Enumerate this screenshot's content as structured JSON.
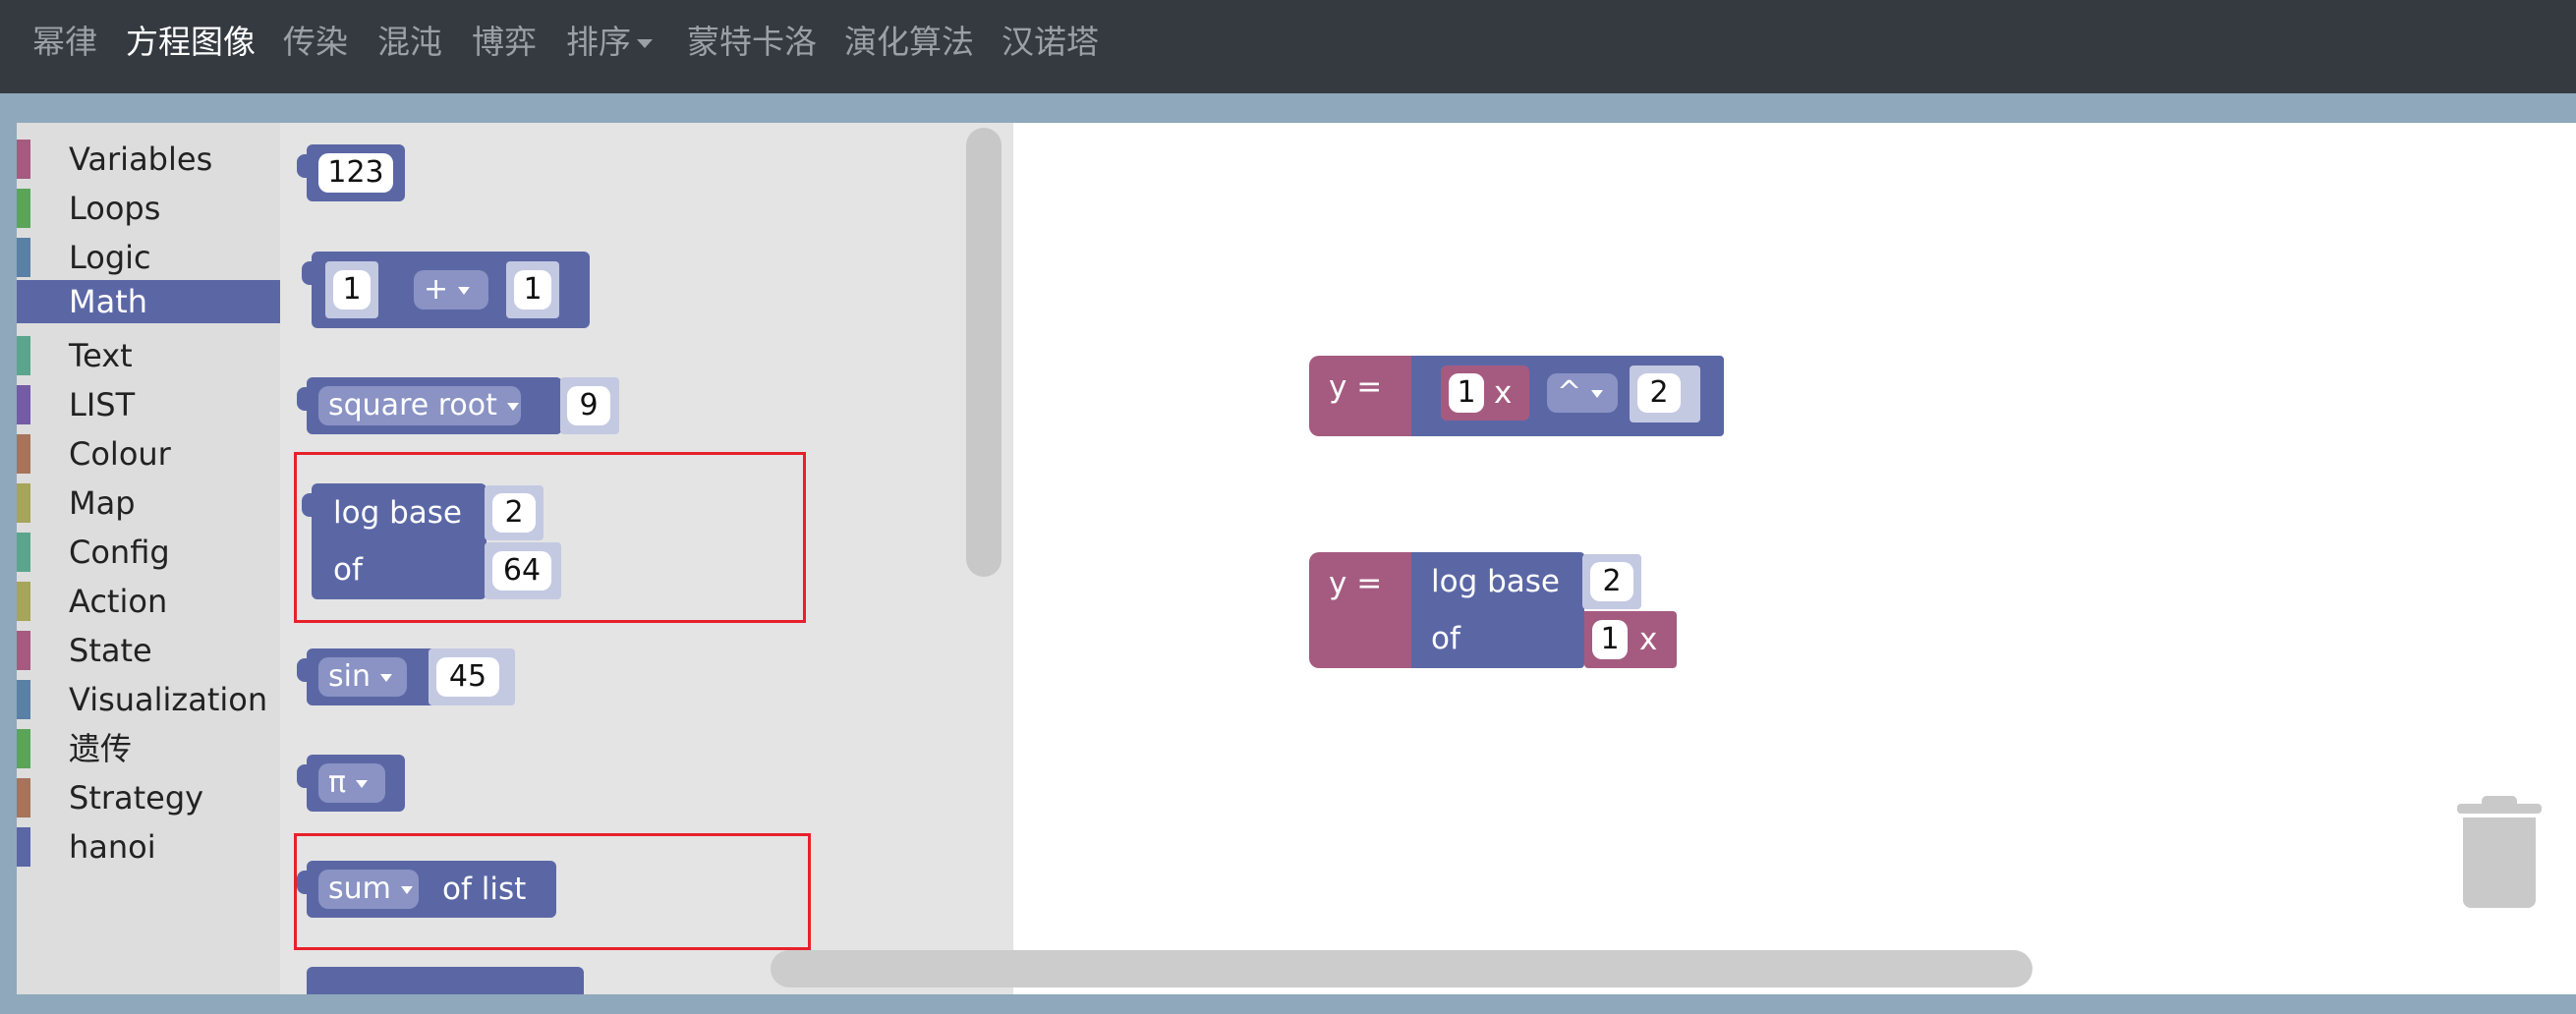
{
  "nav": {
    "items": [
      "幂律",
      "方程图像",
      "传染",
      "混沌",
      "博弈",
      "排序",
      "蒙特卡洛",
      "演化算法",
      "汉诺塔"
    ],
    "active": "方程图像"
  },
  "toolbox": {
    "categories": [
      {
        "label": "Variables",
        "color": "#a55b80"
      },
      {
        "label": "Loops",
        "color": "#5ba55b"
      },
      {
        "label": "Logic",
        "color": "#5b80a5"
      },
      {
        "label": "Math",
        "color": "#5b67a5"
      },
      {
        "label": "Text",
        "color": "#5ba58c"
      },
      {
        "label": "LIST",
        "color": "#745ba5"
      },
      {
        "label": "Colour",
        "color": "#a5745b"
      },
      {
        "label": "Map",
        "color": "#a5a55b"
      },
      {
        "label": "Config",
        "color": "#5ba58c"
      },
      {
        "label": "Action",
        "color": "#a5a55b"
      },
      {
        "label": "State",
        "color": "#a55b80"
      },
      {
        "label": "Visualization",
        "color": "#5b80a5"
      },
      {
        "label": "遗传",
        "color": "#5ba55b"
      },
      {
        "label": "Strategy",
        "color": "#a5745b"
      },
      {
        "label": "hanoi",
        "color": "#5b67a5"
      }
    ],
    "selected": "Math"
  },
  "flyout": {
    "number": "123",
    "arith": {
      "a": "1",
      "op": "+",
      "b": "1"
    },
    "sqrt": {
      "fn": "square root",
      "value": "9"
    },
    "log": {
      "label1": "log base",
      "base": "2",
      "label2": "of",
      "value": "64"
    },
    "trig": {
      "fn": "sin",
      "value": "45"
    },
    "constant": {
      "value": "π"
    },
    "list": {
      "op": "sum",
      "label": "of list"
    }
  },
  "canvas": {
    "block1": {
      "label": "y =",
      "coef": "1",
      "var": "x",
      "op": "^",
      "exp": "2"
    },
    "block2": {
      "label": "y =",
      "log_label": "log base",
      "base": "2",
      "of_label": "of",
      "coef": "1",
      "var": "x"
    }
  },
  "colors": {
    "math_block": "#5b67a5",
    "variable_block": "#a55b80",
    "highlight": "#e8202a",
    "navbar": "#343a40"
  },
  "icons": {
    "trash": "trash-icon"
  }
}
